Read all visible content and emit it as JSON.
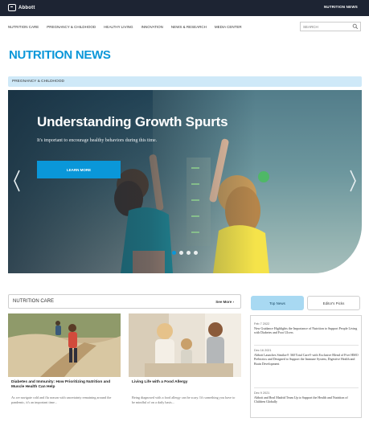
{
  "brand": {
    "logo_text": "Abbott",
    "top_link": "NUTRITION NEWS"
  },
  "nav": {
    "items": [
      {
        "label": "NUTRITION CARE"
      },
      {
        "label": "PREGNANCY & CHILDHOOD"
      },
      {
        "label": "HEALTHY LIVING"
      },
      {
        "label": "INNOVATION"
      },
      {
        "label": "NEWS & RESEARCH"
      },
      {
        "label": "MEDIA CENTER"
      }
    ],
    "search_placeholder": "SEARCH"
  },
  "page_title": "NUTRITION NEWS",
  "section_band": "PREGNANCY & CHILDHOOD",
  "hero": {
    "title": "Understanding Growth Spurts",
    "subtitle": "It's important to encourage healthy behaviors during this time.",
    "cta": "LEARN MORE",
    "slides": 4,
    "active_slide": 1
  },
  "nutrition_care": {
    "title": "NUTRITION CARE",
    "see_more": "See More",
    "cards": [
      {
        "title": "Diabetes and Immunity: How Prioritizing Nutrition and Muscle Health Can Help",
        "text": "As we navigate cold and flu season with uncertainty remaining around the pandemic, it's an important time..."
      },
      {
        "title": "Living Life with a Food Allergy",
        "text": "Being diagnosed with a food allergy can be scary. It's something you have to be mindful of on a daily basis..."
      }
    ]
  },
  "news_tabs": {
    "top": "Top News",
    "editors": "Editor's Picks"
  },
  "news": [
    {
      "date": "Feb 7 2022",
      "title": "New Guidance Highlights the Importance of Nutrition to Support People Living with Diabetes and Foot Ulcers"
    },
    {
      "date": "Dec 16 2021",
      "title": "Abbott Launches Similac® 360 Total Care® with Exclusive Blend of Five HMO Prebiotics and Designed to Support the Immune System, Digestive Health and Brain Development"
    },
    {
      "date": "Dec 9 2021",
      "title": "Abbott and Real Madrid Team Up to Support the Health and Nutrition of Children Globally"
    }
  ],
  "colors": {
    "accent": "#0a97d9",
    "topbar": "#1d2433",
    "band": "#cfe9f8"
  }
}
